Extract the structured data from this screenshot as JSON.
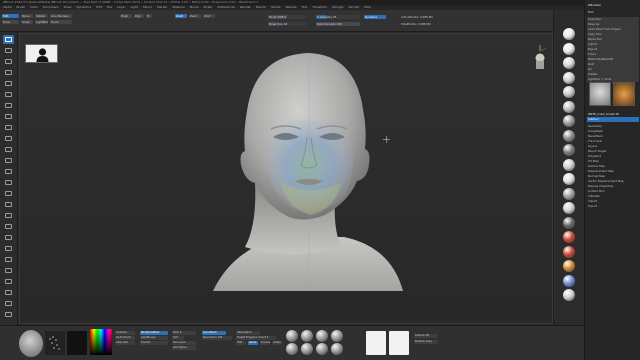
{
  "titlebar": {
    "text": "ZBrush 2022.0.5 [JoshuaMedia]   ZBrush Document   --- Free Mem 5.29GB • Active Mem 2074 • Scratch Disk 74 • ZTime 1.00 • RTime 0.00 • PolyCount 2.09 • MeshCount 1",
    "window_controls": "— ☐ ✕"
  },
  "menu": [
    "Alpha",
    "Brush",
    "Color",
    "Document",
    "Draw",
    "Dynamics",
    "Edit",
    "File",
    "Layer",
    "Light",
    "Macro",
    "Marker",
    "Material",
    "Movie",
    "Picker",
    "Preferences",
    "Render",
    "Stencil",
    "Stroke",
    "Texture",
    "Tool",
    "Transform",
    "Zplugin",
    "Zscript",
    "Help"
  ],
  "top": {
    "rgb_label": "Rgb",
    "mrgb_label": "Mrgb",
    "m_label": "M",
    "zadd_label": "Zadd",
    "zsub_label": "Zsub",
    "zcut_label": "Zcut",
    "focal_shift": "Focal Shift 0",
    "draw_size": "Draw Size 64",
    "z_intensity": "Z Intensity 25",
    "rgb_intensity": "Rgb Intensity 100",
    "dynamic_label": "Dynamic",
    "active_points": "ActivePoints: 2.088 Mil",
    "total_points": "TotalPoints: 2.088 Mil",
    "quick_label": "Quick",
    "edit_label": "Edit",
    "draw_label": "Draw",
    "move_label": "Move",
    "scale_label": "Scale",
    "rotate_label": "Rotate",
    "lightbox_label": "LightBox",
    "live_boolean": "Live Boolean"
  },
  "right_shelf_icons": [
    "bpr-icon",
    "spix-icon",
    "scroll-icon",
    "zoom-icon",
    "actual-icon",
    "aahalf-icon",
    "persp-icon",
    "floor-icon",
    "local-icon",
    "lsym-icon",
    "xyz-icon",
    "frame-icon",
    "move-icon",
    "scale-icon",
    "rotate-icon",
    "polyf-icon",
    "transp-icon",
    "solo-icon",
    "xpose-icon"
  ],
  "tray": {
    "title": "ZModeler",
    "tool_title": "Tool",
    "items": [
      {
        "label": "Load Tool",
        "kind": "btn"
      },
      {
        "label": "Save As",
        "kind": "btn"
      },
      {
        "label": "Load Tools From Project",
        "kind": "btn"
      },
      {
        "label": "Copy Tool",
        "kind": "btn"
      },
      {
        "label": "Paste Tool",
        "kind": "btn"
      },
      {
        "label": "Import",
        "kind": "btn"
      },
      {
        "label": "Export",
        "kind": "btn"
      },
      {
        "label": "Clone",
        "kind": "btn"
      },
      {
        "label": "Make PolyMesh3D",
        "kind": "btn"
      },
      {
        "label": "GoZ",
        "kind": "btn"
      },
      {
        "label": "All",
        "kind": "btn"
      },
      {
        "label": "Visible",
        "kind": "btn"
      },
      {
        "label": "Lightbox > Tools",
        "kind": "btn"
      },
      {
        "label": "PM3D_head_Sculpt 48",
        "kind": "hdr"
      },
      {
        "label": "Subtool",
        "kind": "hdr"
      },
      {
        "label": "Geometry",
        "kind": "item"
      },
      {
        "label": "ArrayMesh",
        "kind": "item"
      },
      {
        "label": "NanoMesh",
        "kind": "item"
      },
      {
        "label": "Thick Skin",
        "kind": "item"
      },
      {
        "label": "Layers",
        "kind": "item"
      },
      {
        "label": "Morph Target",
        "kind": "item"
      },
      {
        "label": "Polypaint",
        "kind": "item"
      },
      {
        "label": "UV Map",
        "kind": "item"
      },
      {
        "label": "Texture Map",
        "kind": "item"
      },
      {
        "label": "Displacement Map",
        "kind": "item"
      },
      {
        "label": "Normal Map",
        "kind": "item"
      },
      {
        "label": "Vector Displacement Map",
        "kind": "item"
      },
      {
        "label": "Display Properties",
        "kind": "item"
      },
      {
        "label": "Unified Skin",
        "kind": "item"
      },
      {
        "label": "Initialize",
        "kind": "item"
      },
      {
        "label": "Import",
        "kind": "item"
      },
      {
        "label": "Export",
        "kind": "item"
      }
    ],
    "deformation_items": [
      "Closed Holes",
      "Fill 1",
      "Smooth",
      "Inflate",
      "Flatten",
      "Bend Arc",
      "Taper"
    ],
    "bottom_items": [
      "ZRemesher",
      "Geometry HD",
      "Preview",
      "Surface",
      "Deformation",
      "Masking",
      "Visibility",
      "Polygroups",
      "Contact",
      "Morph Target",
      "Polypaint",
      "UV Map",
      "Texture Map",
      "Displacement Map",
      "Normal Map",
      "Vector Displacement Map",
      "Display Properties",
      "Unified Skin",
      "Initialize",
      "Import",
      "Export"
    ]
  },
  "bottom": {
    "stroke_label": "Stroke",
    "alpha_label": "Alpha",
    "texture_label": "Texture Off",
    "material_label": "MatCap Gray",
    "gradient_label": "Gradient",
    "switch_color": "SwitchColor",
    "alternate": "Alternate",
    "backface_mask": "BackfaceMask",
    "lazy_mouse": "LazyMouse",
    "double": "Double",
    "sdiv": "SDiv 6",
    "smt": "Smt",
    "del_lower": "Del Lower",
    "del_higher": "Del Higher",
    "dynamesh": "DynaMesh",
    "resolution": "Resolution 128",
    "zremesher": "ZRemesher",
    "target_count": "Target Polygons Count 5",
    "half": "Half",
    "same": "Same",
    "double2": "Double",
    "adapt": "Adapt"
  },
  "colors": {
    "accent": "#2e6fb5",
    "canvas_bg": "#2b2b2b",
    "ui_bg": "#303030"
  }
}
